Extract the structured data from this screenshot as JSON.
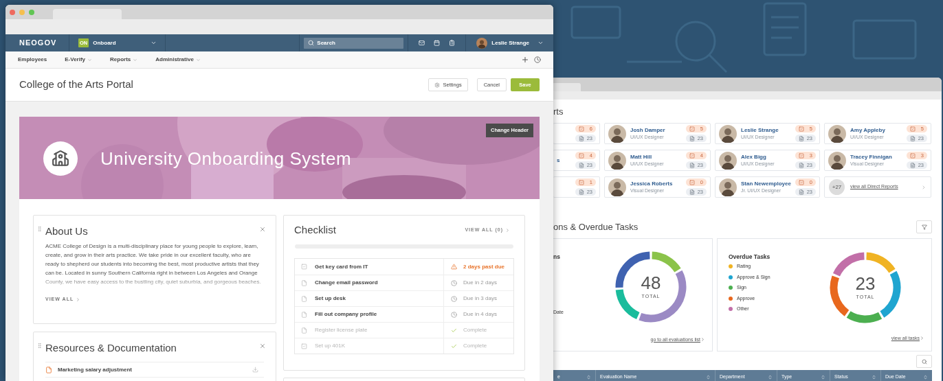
{
  "front_window": {
    "app_bar": {
      "logo": "NEOGOV",
      "module": {
        "badge": "ON",
        "label": "Onboard"
      },
      "search": {
        "placeholder": "Search"
      },
      "user": {
        "name": "Leslie Strange"
      }
    },
    "nav": [
      {
        "label": "Employees",
        "dropdown": false
      },
      {
        "label": "E-Verify",
        "dropdown": true
      },
      {
        "label": "Reports",
        "dropdown": true
      },
      {
        "label": "Administrative",
        "dropdown": true
      }
    ],
    "page_title": "College of the Arts Portal",
    "buttons": [
      {
        "label": "Settings",
        "kind": "settings"
      },
      {
        "label": "Cancel",
        "kind": "secondary"
      },
      {
        "label": "Save",
        "kind": "primary"
      }
    ],
    "banner": {
      "title": "University Onboarding System",
      "button": "Change Header"
    },
    "about": {
      "title": "About Us",
      "body": "ACME College of Design is a multi-disciplinary place for young people to explore, learn, create, and grow in their arts practice. We take pride in our excellent faculty, who are ready to shepherd our students into becoming the best, most productive artists that they can be. Located in sunny Southern California right in between Los Angeles and Orange County, we have easy access to the bustling city, quiet suburbia, and gorgeous beaches.",
      "link": "VIEW ALL"
    },
    "resources": {
      "title": "Resources & Documentation",
      "items": [
        {
          "name": "Marketing salary adjustment"
        }
      ]
    },
    "checklist": {
      "title": "Checklist",
      "link": "VIEW ALL (0)",
      "progress": {
        "level": 0
      },
      "tasks": [
        {
          "name": "Get key card from IT",
          "kind": "checkbox",
          "overdue": true,
          "complete": false,
          "due": "2 days past due"
        },
        {
          "name": "Change email password",
          "kind": "form",
          "overdue": false,
          "complete": false,
          "due": "Due in 2 days"
        },
        {
          "name": "Set up desk",
          "kind": "form",
          "overdue": false,
          "complete": false,
          "due": "Due in 3 days"
        },
        {
          "name": "Fill out company profile",
          "kind": "form",
          "overdue": false,
          "complete": false,
          "due": "Due in 4 days"
        },
        {
          "name": "Register license plate",
          "kind": "form",
          "overdue": false,
          "complete": true,
          "due": "Complete"
        },
        {
          "name": "Set up 401K",
          "kind": "checkbox",
          "overdue": false,
          "complete": true,
          "due": "Complete"
        }
      ]
    }
  },
  "back_window": {
    "reports_title": "rts",
    "people": [
      {
        "tasks": "6",
        "docs": "23"
      },
      {
        "name": "Josh Damper",
        "role": "UI/UX Designer",
        "tasks": "5",
        "docs": "23"
      },
      {
        "name": "Leslie Strange",
        "role": "UI/UX Designer",
        "tasks": "5",
        "docs": "23"
      },
      {
        "name": "Amy Appleby",
        "role": "UI/UX Designer",
        "tasks": "5",
        "docs": "23"
      },
      {
        "name": "s",
        "tasks": "4",
        "docs": "23"
      },
      {
        "name": "Matt Hill",
        "role": "UI/UX Designer",
        "tasks": "4",
        "docs": "23"
      },
      {
        "name": "Alex Bigg",
        "role": "UI/UX Designer",
        "tasks": "3",
        "docs": "23"
      },
      {
        "name": "Tracey Finnigan",
        "role": "Visual Designer",
        "tasks": "3",
        "docs": "23"
      },
      {
        "tasks": "1",
        "docs": "23"
      },
      {
        "name": "Jessica Roberts",
        "role": "Visual Designer",
        "tasks": "0",
        "docs": "23"
      },
      {
        "name": "Stan Newemployee",
        "role": "Jr. UI/UX Designer",
        "tasks": "0",
        "docs": "23"
      }
    ],
    "more": {
      "count": "+27",
      "link": "view all Direct Reports"
    },
    "tasks_title": "ons & Overdue Tasks",
    "evaluations": {
      "title": "ns",
      "legend": [
        {
          "label": "Date"
        }
      ],
      "total": "48",
      "total_label": "TOTAL",
      "link": "go to all evaluations list"
    },
    "overdue": {
      "title": "Overdue Tasks",
      "legend": [
        {
          "label": "Rating",
          "color": "#f0b323"
        },
        {
          "label": "Approve & Sign",
          "color": "#1fa5d0"
        },
        {
          "label": "Sign",
          "color": "#4caf50"
        },
        {
          "label": "Approve",
          "color": "#e8681e"
        },
        {
          "label": "Other",
          "color": "#c26fa8"
        }
      ],
      "total": "23",
      "total_label": "TOTAL",
      "link": "view all tasks"
    },
    "table": {
      "columns": [
        "e",
        "Evaluation Name",
        "Department",
        "Type",
        "Status",
        "Due Date"
      ]
    }
  }
}
